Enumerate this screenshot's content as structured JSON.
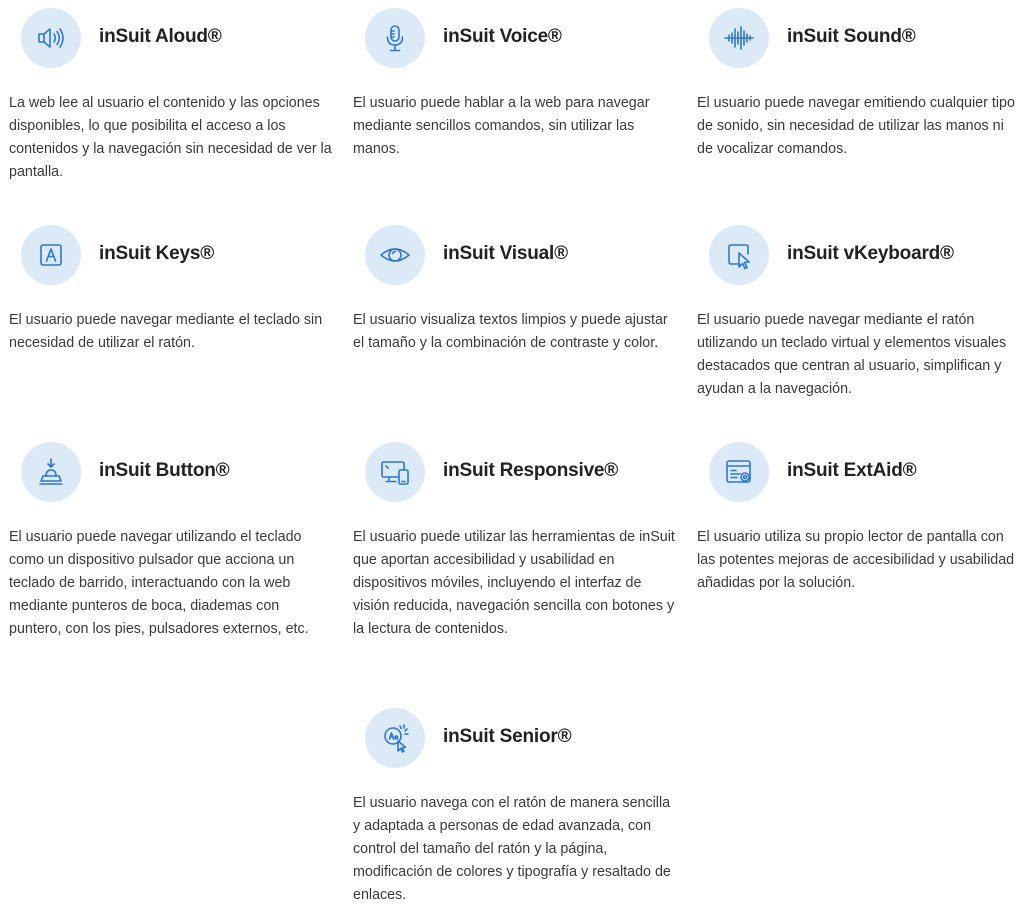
{
  "colors": {
    "icon_stroke": "#2d78d6",
    "icon_bg": "#dce9f7",
    "title": "#222222",
    "text": "#3a3a3a"
  },
  "cards": [
    {
      "id": "aloud",
      "icon": "speaker-icon",
      "title": "inSuit Aloud®",
      "description": "La web lee al usuario el contenido y las opciones disponibles, lo que posibilita el acceso a los contenidos y la navegación sin necesidad de ver la pantalla."
    },
    {
      "id": "voice",
      "icon": "microphone-icon",
      "title": "inSuit Voice®",
      "description": "El usuario puede hablar a la web para navegar mediante sencillos comandos, sin utilizar las manos."
    },
    {
      "id": "sound",
      "icon": "sound-wave-icon",
      "title": "inSuit Sound®",
      "description": "El usuario puede navegar emitiendo cualquier tipo de sonido, sin necesidad de utilizar las manos ni de vocalizar comandos."
    },
    {
      "id": "keys",
      "icon": "key-a-icon",
      "title": "inSuit Keys®",
      "description": "El usuario puede navegar mediante el teclado sin necesidad de utilizar el ratón."
    },
    {
      "id": "visual",
      "icon": "eye-icon",
      "title": "inSuit Visual®",
      "description": "El usuario visualiza textos limpios y puede ajustar el tamaño y la combinación de contraste y color."
    },
    {
      "id": "vkeyboard",
      "icon": "pointer-window-icon",
      "title": "inSuit vKeyboard®",
      "description": "El usuario puede navegar mediante el ratón utilizando un teclado virtual y elementos visuales destacados que centran al usuario, simplifican y ayudan a la navegación."
    },
    {
      "id": "button",
      "icon": "push-button-icon",
      "title": "inSuit Button®",
      "description": "El usuario puede navegar utilizando el teclado como un dispositivo pulsador que acciona un teclado de barrido, interactuando con la web mediante punteros de boca, diademas con puntero, con los pies, pulsadores externos, etc."
    },
    {
      "id": "responsive",
      "icon": "devices-icon",
      "title": "inSuit Responsive®",
      "description": "El usuario puede utilizar las herramientas de inSuit que aportan accesibilidad y usabilidad en dispositivos móviles, incluyendo el interfaz de visión reducida, navegación sencilla con botones y la lectura de contenidos."
    },
    {
      "id": "extaid",
      "icon": "screen-reader-icon",
      "title": "inSuit ExtAid®",
      "description": "El usuario utiliza su propio lector de pantalla con las potentes mejoras de accesibilidad y usabilidad añadidas por la solución."
    },
    {
      "id": "senior",
      "icon": "text-zoom-icon",
      "title": "inSuit Senior®",
      "description": "El usuario navega con el ratón de manera sencilla y adaptada a personas de edad avanzada, con control del tamaño del ratón y la página, modificación de colores y tipografía y resaltado de enlaces."
    }
  ]
}
